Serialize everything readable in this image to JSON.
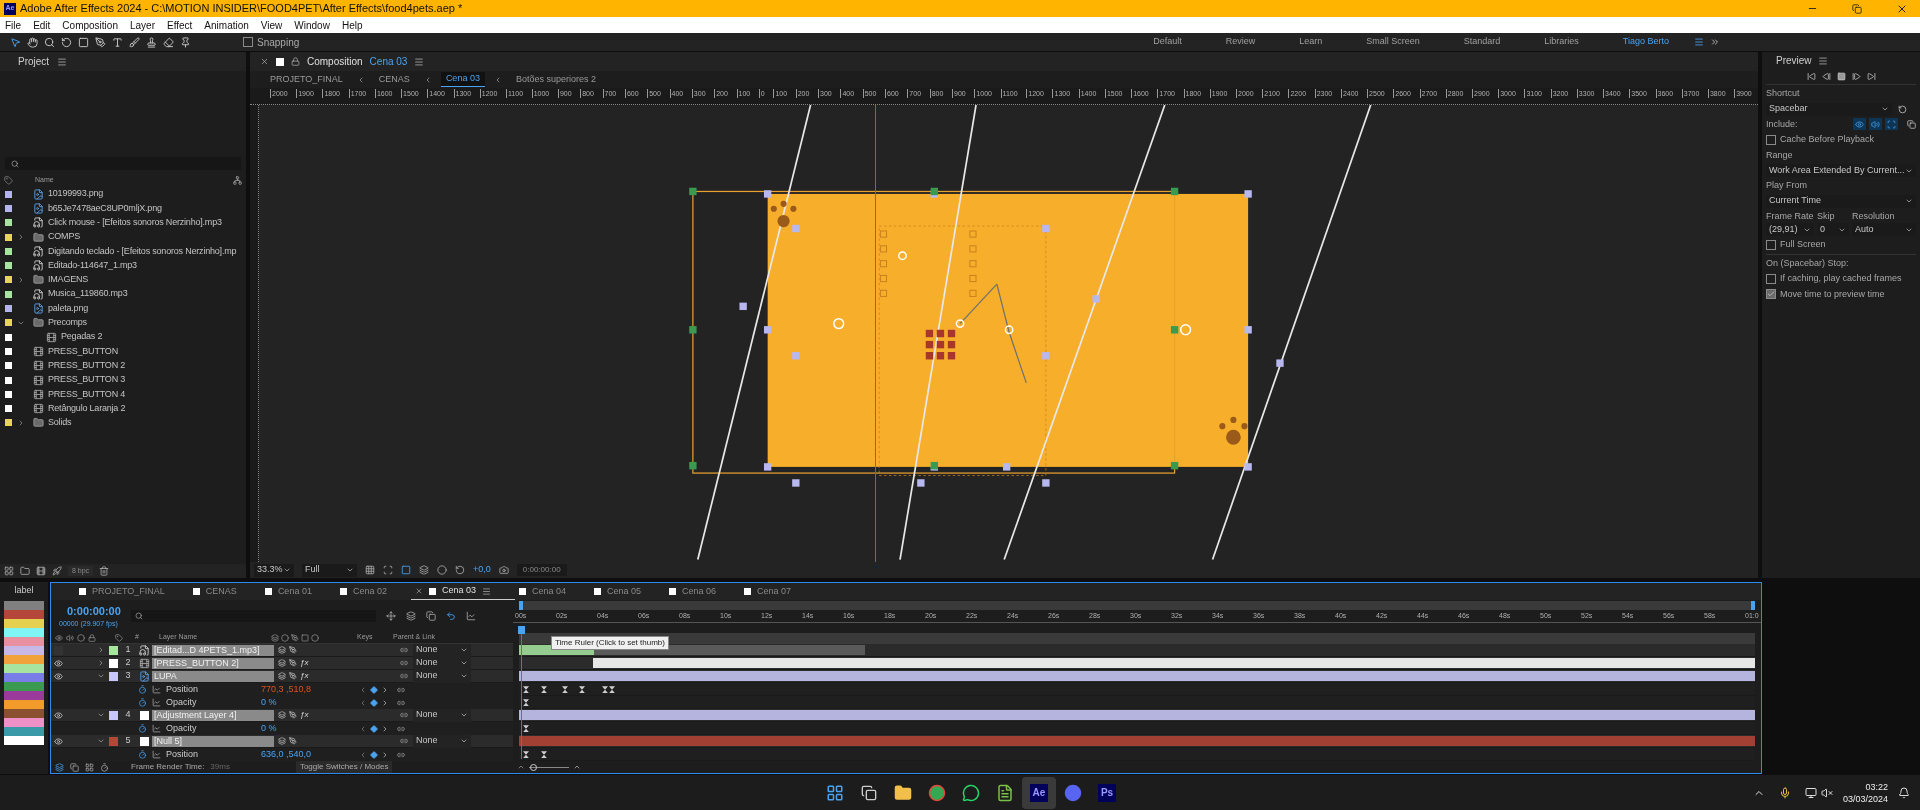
{
  "title_bar": {
    "app_badge": "Ae",
    "title": "Adobe After Effects 2024 - C:\\MOTION INSIDER\\FOOD4PET\\After Effects\\food4pets.aep *"
  },
  "menu": [
    "File",
    "Edit",
    "Composition",
    "Layer",
    "Effect",
    "Animation",
    "View",
    "Window",
    "Help"
  ],
  "toolbar": {
    "snapping": {
      "label": "Snapping",
      "checked": false
    }
  },
  "workspaces": [
    {
      "label": "Default",
      "selected": false
    },
    {
      "label": "Review",
      "selected": false
    },
    {
      "label": "Learn",
      "selected": false
    },
    {
      "label": "Small Screen",
      "selected": false
    },
    {
      "label": "Standard",
      "selected": false
    },
    {
      "label": "Libraries",
      "selected": false
    },
    {
      "label": "Tiago Berto",
      "selected": true
    }
  ],
  "project": {
    "title": "Project",
    "column_name": "Name",
    "bpc": "8 bpc",
    "items": [
      {
        "kind": "image",
        "name": "10199993.png",
        "color": "#b4b4f0"
      },
      {
        "kind": "image",
        "name": "b65Je7478aeC8UP0mljX.png",
        "color": "#b4b4f0"
      },
      {
        "kind": "audio",
        "name": "Click mouse - [Efeitos sonoros Nerzinho].mp3",
        "color": "#a6e4a0"
      },
      {
        "kind": "folder",
        "name": "COMPS",
        "color": "#e8d45a",
        "expanded": false
      },
      {
        "kind": "audio",
        "name": "Digitando teclado - [Efeitos sonoros Nerzinho].mp",
        "color": "#a6e4a0"
      },
      {
        "kind": "audio",
        "name": "Editado-114647_1.mp3",
        "color": "#a6e4a0"
      },
      {
        "kind": "folder",
        "name": "IMAGENS",
        "color": "#e8d45a",
        "expanded": false
      },
      {
        "kind": "audio",
        "name": "Musica_119860.mp3",
        "color": "#a6e4a0"
      },
      {
        "kind": "image",
        "name": "paleta.png",
        "color": "#b4b4f0"
      },
      {
        "kind": "folder",
        "name": "Precomps",
        "color": "#e8d45a",
        "expanded": true,
        "children": [
          {
            "kind": "comp",
            "name": "Pegadas 2",
            "color": "#ffffff"
          }
        ]
      },
      {
        "kind": "comp",
        "name": "PRESS_BUTTON",
        "color": "#ffffff"
      },
      {
        "kind": "comp",
        "name": "PRESS_BUTTON 2",
        "color": "#ffffff"
      },
      {
        "kind": "comp",
        "name": "PRESS_BUTTON 3",
        "color": "#ffffff"
      },
      {
        "kind": "comp",
        "name": "PRESS_BUTTON 4",
        "color": "#ffffff"
      },
      {
        "kind": "comp",
        "name": "Retângulo Laranja 2",
        "color": "#ffffff"
      },
      {
        "kind": "folder",
        "name": "Solids",
        "color": "#e8d45a",
        "expanded": false
      }
    ]
  },
  "composition": {
    "tab_label": "Composition",
    "tab_name": "Cena 03",
    "breadcrumbs": [
      {
        "label": "PROJETO_FINAL",
        "selected": false
      },
      {
        "label": "CENAS",
        "selected": false
      },
      {
        "label": "Cena 03",
        "selected": true
      },
      {
        "label": "Botões superiores 2",
        "selected": false
      }
    ],
    "ruler": [
      "2000",
      "1900",
      "1800",
      "1700",
      "1600",
      "1500",
      "1400",
      "1300",
      "1200",
      "1100",
      "1000",
      "900",
      "800",
      "700",
      "600",
      "500",
      "400",
      "300",
      "200",
      "100",
      "0",
      "100",
      "200",
      "300",
      "400",
      "500",
      "600",
      "700",
      "800",
      "900",
      "1000",
      "1100",
      "1200",
      "1300",
      "1400",
      "1500",
      "1600",
      "1700",
      "1800",
      "1900",
      "2000",
      "2100",
      "2200",
      "2300",
      "2400",
      "2500",
      "2600",
      "2700",
      "2800",
      "2900",
      "3000",
      "3100",
      "3200",
      "3300",
      "3400",
      "3500",
      "3600",
      "3700",
      "3800",
      "3900"
    ],
    "zoom": "33.3%",
    "resolution": "Full",
    "exposure": "+0,0",
    "timecode": "0:00:00:00"
  },
  "preview": {
    "title": "Preview",
    "shortcut_label": "Shortcut",
    "shortcut": "Spacebar",
    "include_label": "Include:",
    "include": [
      {
        "kind": "video",
        "on": true
      },
      {
        "kind": "audio",
        "on": true
      },
      {
        "kind": "overlays",
        "on": true
      }
    ],
    "cache": {
      "label": "Cache Before Playback",
      "checked": false
    },
    "range_label": "Range",
    "range": "Work Area Extended By Current...",
    "play_from_label": "Play From",
    "play_from": "Current Time",
    "frame_rate_label": "Frame Rate",
    "frame_rate": "(29,91)",
    "skip_label": "Skip",
    "skip": "0",
    "resolution_label": "Resolution",
    "resolution": "Auto",
    "full_screen": {
      "label": "Full Screen",
      "checked": false
    },
    "stop_label": "On (Spacebar) Stop:",
    "stop_options": [
      {
        "label": "If caching, play cached frames",
        "checked": false
      },
      {
        "label": "Move time to preview time",
        "checked": true
      }
    ]
  },
  "timeline": {
    "label_header": "label",
    "label_colors": [
      {
        "color": "#808080"
      },
      {
        "color": "#b5473a"
      },
      {
        "color": "#e5d14f"
      },
      {
        "color": "#7ff5f5"
      },
      {
        "color": "#e890a0"
      },
      {
        "color": "#c8b8e8"
      },
      {
        "color": "#f2a23a"
      },
      {
        "color": "#a6e4a0"
      },
      {
        "color": "#7a7ce8"
      },
      {
        "color": "#3a9a50"
      },
      {
        "color": "#9a3a9a"
      },
      {
        "color": "#f29a2a"
      },
      {
        "color": "#8a5030"
      },
      {
        "color": "#f090c8"
      },
      {
        "color": "#3a9aa8"
      },
      {
        "color": "#ffffff"
      }
    ],
    "tabs": [
      {
        "label": "PROJETO_FINAL",
        "selected": false
      },
      {
        "label": "CENAS",
        "selected": false
      },
      {
        "label": "Cena 01",
        "selected": false
      },
      {
        "label": "Cena 02",
        "selected": false
      },
      {
        "label": "Cena 03",
        "selected": true
      },
      {
        "label": "Cena 04",
        "selected": false
      },
      {
        "label": "Cena 05",
        "selected": false
      },
      {
        "label": "Cena 06",
        "selected": false
      },
      {
        "label": "Cena 07",
        "selected": false
      }
    ],
    "timecode": "0:00:00:00",
    "frame_info": "00000 (29.907 fps)",
    "columns": {
      "number": "#",
      "layer_name": "Layer Name",
      "keys": "Keys",
      "parent": "Parent & Link"
    },
    "ruler": [
      "00s",
      "02s",
      "04s",
      "06s",
      "08s",
      "10s",
      "12s",
      "14s",
      "16s",
      "18s",
      "20s",
      "22s",
      "24s",
      "26s",
      "28s",
      "30s",
      "32s",
      "34s",
      "36s",
      "38s",
      "40s",
      "42s",
      "44s",
      "46s",
      "48s",
      "50s",
      "52s",
      "54s",
      "56s",
      "58s",
      "01:0"
    ],
    "tooltip": "Time Ruler (Click to set thumb)",
    "rows": [
      {
        "kind": "audio-layer",
        "number": "1",
        "name": "[Editad...D 4PETS_1.mp3]",
        "color": "#a6e4a0",
        "visible": false,
        "expanded": false,
        "parent": "None"
      },
      {
        "kind": "comp-layer",
        "number": "2",
        "name": "[PRESS_BUTTON 2]",
        "color": "#ffffff",
        "visible": true,
        "expanded": false,
        "fx": "ƒx",
        "fx_on": true,
        "parent": "None"
      },
      {
        "kind": "image-layer",
        "number": "3",
        "name": "LUPA",
        "color": "#c8c8f8",
        "visible": true,
        "expanded": true,
        "fx": "ƒx",
        "fx_on": true,
        "parent": "None"
      },
      {
        "kind": "property",
        "name": "Position",
        "value": "770,3 ,510,8",
        "highlight": true
      },
      {
        "kind": "property",
        "name": "Opacity",
        "value": "0 %",
        "highlight": false
      },
      {
        "kind": "solid-layer",
        "number": "4",
        "name": "[Adjustment Layer 4]",
        "color": "#c8c8f8",
        "visible": true,
        "expanded": true,
        "fx": "ƒx",
        "fx_on": true,
        "parent": "None"
      },
      {
        "kind": "property",
        "name": "Opacity",
        "value": "0 %",
        "highlight": false
      },
      {
        "kind": "solid-layer",
        "number": "5",
        "name": "[Null 5]",
        "color": "#b5473a",
        "visible": true,
        "expanded": true,
        "parent": "None"
      },
      {
        "kind": "property",
        "name": "Position",
        "value": "636,0 ,540,0",
        "highlight": false
      }
    ],
    "zoom_slider": {
      "level": 0.1
    },
    "render_time_label": "Frame Render Time:",
    "render_time": "39ms",
    "toggle": "Toggle Switches / Modes"
  },
  "taskbar": {
    "apps": [
      {
        "kind": "start",
        "active": false
      },
      {
        "kind": "taskview",
        "active": false
      },
      {
        "kind": "files",
        "active": false
      },
      {
        "kind": "browser",
        "active": false
      },
      {
        "kind": "chat",
        "active": false
      },
      {
        "kind": "notes",
        "active": false
      },
      {
        "kind": "badge",
        "label": "Ae",
        "active": true
      },
      {
        "kind": "discord",
        "active": false
      },
      {
        "kind": "badge",
        "label": "Ps",
        "active": false
      }
    ],
    "time": "03:22",
    "date": "03/03/2024"
  }
}
